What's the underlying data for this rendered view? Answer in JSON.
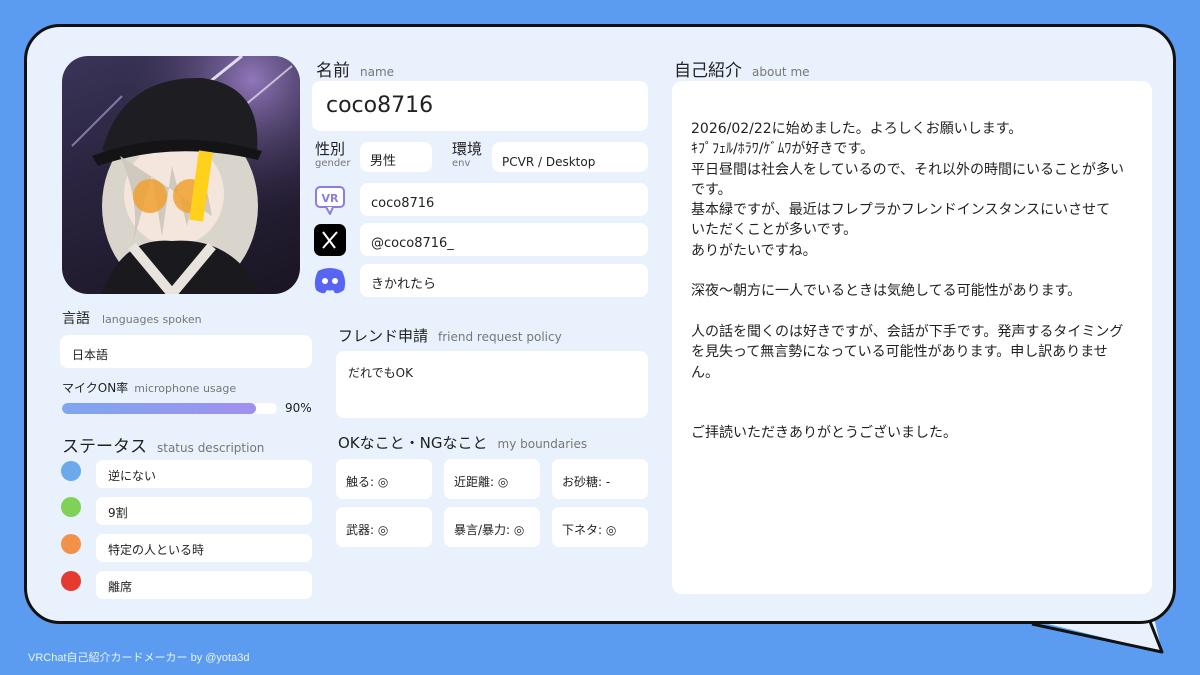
{
  "colors": {
    "background": "#5b9cf0",
    "card": "#e9f1fd",
    "mic_bar": "#9aa6f0",
    "status_blue": "#6aa9ea",
    "status_green": "#7fd157",
    "status_orange": "#f0924a",
    "status_red": "#e43a2f",
    "discord": "#5865f2",
    "vrchat_badge": "#8b7ee0"
  },
  "name": {
    "title": "名前",
    "sub": "name",
    "value": "coco8716"
  },
  "gender": {
    "title": "性別",
    "sub": "gender",
    "value": "男性"
  },
  "env": {
    "title": "環境",
    "sub": "env",
    "value": "PCVR / Desktop"
  },
  "socials": [
    {
      "icon": "vrchat-icon",
      "value": "coco8716"
    },
    {
      "icon": "x-icon",
      "value": "@coco8716_"
    },
    {
      "icon": "discord-icon",
      "value": "きかれたら"
    }
  ],
  "languages": {
    "title": "言語",
    "sub": "languages spoken",
    "value": "日本語"
  },
  "mic": {
    "title": "マイクON率",
    "sub": "microphone usage",
    "percent": 90,
    "percent_label": "90%"
  },
  "status": {
    "title": "ステータス",
    "sub": "status description",
    "items": [
      {
        "color": "blue",
        "label": "逆にない"
      },
      {
        "color": "green",
        "label": "9割"
      },
      {
        "color": "orange",
        "label": "特定の人といる時"
      },
      {
        "color": "red",
        "label": "離席"
      }
    ]
  },
  "friend_request": {
    "title": "フレンド申請",
    "sub": "friend request policy",
    "value": "だれでもOK"
  },
  "boundaries": {
    "title": "OKなこと・NGなこと",
    "sub": "my boundaries",
    "items": [
      "触る: ◎",
      "近距離: ◎",
      "お砂糖: -",
      "武器: ◎",
      "暴言/暴力: ◎",
      "下ネタ: ◎"
    ]
  },
  "about": {
    "title": "自己紹介",
    "sub": "about me",
    "lines": [
      "2026/02/22に始めました。よろしくお願いします。",
      "ｷﾌﾟﾌｪﾙ/ﾎﾗﾜ/ｹﾞﾑﾜが好きです。",
      "平日昼間は社会人をしているので、それ以外の時間にいることが多いです。",
      "基本緑ですが、最近はフレプラかフレンドインスタンスにいさせていただくことが多いです。",
      "ありがたいですね。",
      "",
      "深夜〜朝方に一人でいるときは気絶してる可能性があります。",
      "",
      "人の話を聞くのは好きですが、会話が下手です。発声するタイミングを見失って無言勢になっている可能性があります。申し訳ありません。",
      "",
      "",
      "ご拝読いただきありがとうございました。"
    ]
  },
  "footer": "VRChat自己紹介カードメーカー by @yota3d"
}
